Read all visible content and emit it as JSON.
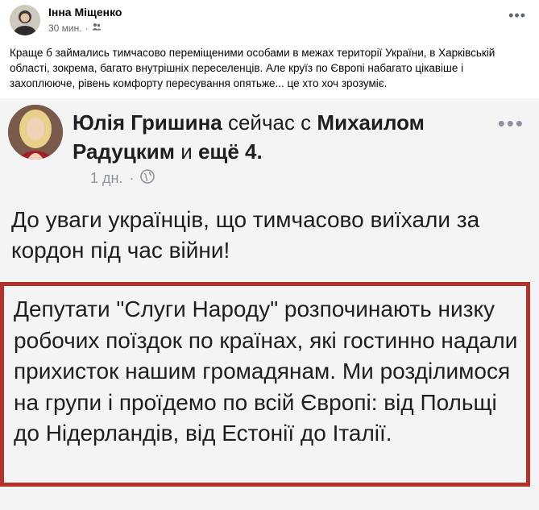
{
  "post": {
    "author": "Інна Міщенко",
    "time": "30 мин.",
    "time_separator": "·",
    "menu_label": "•••",
    "text": "Краще б займались тимчасово переміщеними особами в межах території України, в Харківській області, зокрема, багато внутрішніх переселенців. Але круїз по Європі набагато цікавіше і захоплююче, рівень комфорту пересування опятьже... це хто хоч зрозуміє."
  },
  "shared_screenshot": {
    "author": "Юлія Гришина",
    "with_text": "сейчас с",
    "tagged": "Михаилом Радуцким",
    "and_text": "и",
    "others": "ещё 4.",
    "time": "1 дн.",
    "time_separator": "·",
    "menu_label": "•••",
    "intro": "До уваги українців, що тимчасово виїхали за кордон під час війни!",
    "quote": "Депутати \"Слуги Народу\" розпочинають низку робочих поїздок по країнах, які гостинно надали прихисток нашим громадянам. Ми розділимося на групи і проїдемо по всій Європі: від Польщі до Нідерландів, від Естонії до Італії."
  },
  "colors": {
    "frame_border": "#b5322a",
    "meta_gray": "#65676b"
  },
  "icons": {
    "globe": "globe-icon",
    "friends": "friends-icon"
  }
}
